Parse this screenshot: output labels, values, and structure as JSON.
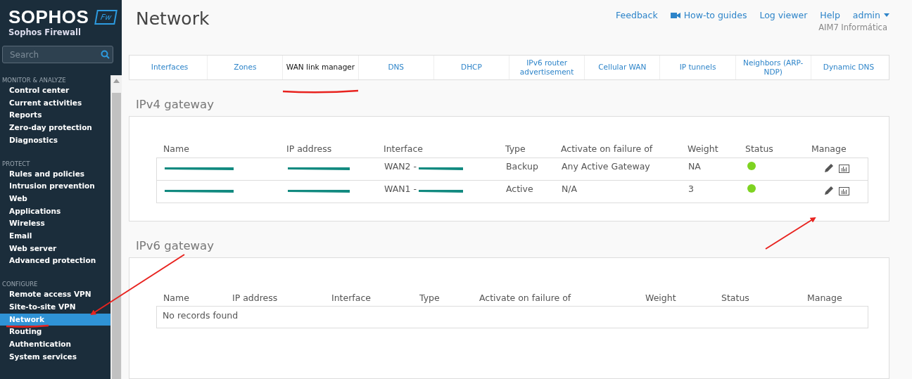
{
  "brand": {
    "logo": "SOPHOS",
    "badge": "Fw",
    "product": "Sophos Firewall"
  },
  "search": {
    "placeholder": "Search"
  },
  "sidebar": [
    {
      "heading": "MONITOR & ANALYZE",
      "items": [
        {
          "label": "Control center",
          "selected": false
        },
        {
          "label": "Current activities",
          "selected": false
        },
        {
          "label": "Reports",
          "selected": false
        },
        {
          "label": "Zero-day protection",
          "selected": false
        },
        {
          "label": "Diagnostics",
          "selected": false
        }
      ]
    },
    {
      "heading": "PROTECT",
      "items": [
        {
          "label": "Rules and policies",
          "selected": false
        },
        {
          "label": "Intrusion prevention",
          "selected": false
        },
        {
          "label": "Web",
          "selected": false
        },
        {
          "label": "Applications",
          "selected": false
        },
        {
          "label": "Wireless",
          "selected": false
        },
        {
          "label": "Email",
          "selected": false
        },
        {
          "label": "Web server",
          "selected": false
        },
        {
          "label": "Advanced protection",
          "selected": false
        }
      ]
    },
    {
      "heading": "CONFIGURE",
      "items": [
        {
          "label": "Remote access VPN",
          "selected": false
        },
        {
          "label": "Site-to-site VPN",
          "selected": false
        },
        {
          "label": "Network",
          "selected": true
        },
        {
          "label": "Routing",
          "selected": false
        },
        {
          "label": "Authentication",
          "selected": false
        },
        {
          "label": "System services",
          "selected": false
        }
      ]
    }
  ],
  "page_title": "Network",
  "top_links": [
    {
      "kind": "link",
      "label": "Feedback"
    },
    {
      "kind": "video",
      "label": "How-to guides"
    },
    {
      "kind": "link",
      "label": "Log viewer"
    },
    {
      "kind": "link",
      "label": "Help"
    },
    {
      "kind": "menu",
      "label": "admin"
    }
  ],
  "organization": "AIM7 Informática",
  "tabs": [
    {
      "label": "Interfaces",
      "selected": false
    },
    {
      "label": "Zones",
      "selected": false
    },
    {
      "label": "WAN link manager",
      "selected": true
    },
    {
      "label": "DNS",
      "selected": false
    },
    {
      "label": "DHCP",
      "selected": false
    },
    {
      "label": "IPv6 router advertisement",
      "selected": false
    },
    {
      "label": "Cellular WAN",
      "selected": false
    },
    {
      "label": "IP tunnels",
      "selected": false
    },
    {
      "label": "Neighbors (ARP-NDP)",
      "selected": false
    },
    {
      "label": "Dynamic DNS",
      "selected": false
    }
  ],
  "ipv4": {
    "title": "IPv4 gateway",
    "columns": [
      "Name",
      "IP address",
      "Interface",
      "Type",
      "Activate on failure of",
      "Weight",
      "Status",
      "Manage"
    ],
    "rows": [
      {
        "name": {
          "redacted": true
        },
        "ip": {
          "redacted": true
        },
        "interface": {
          "text": "WAN2 -",
          "redacted": true
        },
        "type": "Backup",
        "failover": "Any Active Gateway",
        "weight": "NA",
        "color": "#7ed321"
      },
      {
        "name": {
          "redacted": true
        },
        "ip": {
          "redacted": true
        },
        "interface": {
          "text": "WAN1 -",
          "redacted": true
        },
        "type": "Active",
        "failover": "N/A",
        "weight": "3",
        "color": "#7ed321"
      }
    ]
  },
  "ipv6": {
    "title": "IPv6 gateway",
    "columns": [
      "Name",
      "IP address",
      "Interface",
      "Type",
      "Activate on failure of",
      "Weight",
      "Status",
      "Manage"
    ],
    "empty": "No records found"
  }
}
